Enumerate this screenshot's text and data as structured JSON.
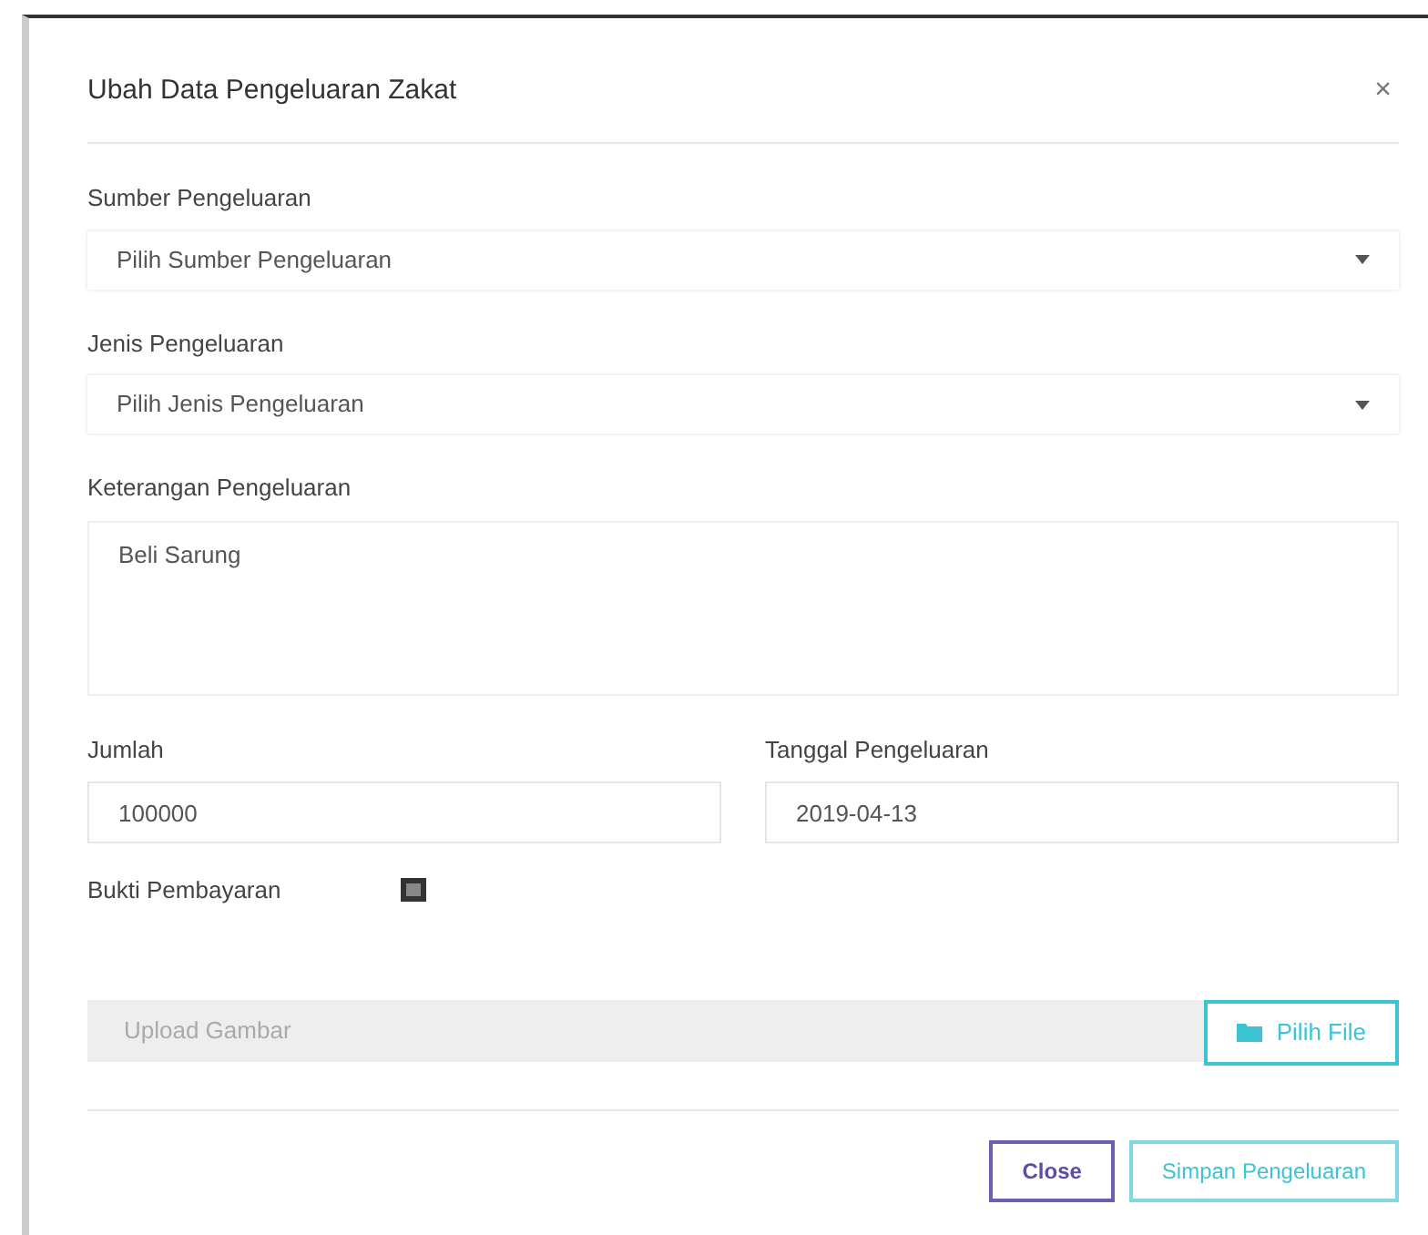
{
  "modal": {
    "title": "Ubah Data Pengeluaran Zakat",
    "close": "×"
  },
  "fields": [
    {
      "kind": "select",
      "label": "Sumber Pengeluaran",
      "value": "Pilih Sumber Pengeluaran"
    },
    {
      "kind": "select",
      "label": "Jenis Pengeluaran",
      "value": "Pilih Jenis Pengeluaran"
    },
    {
      "kind": "textarea",
      "label": "Keterangan Pengeluaran",
      "value": "Beli Sarung"
    }
  ],
  "row": [
    {
      "label": "Jumlah",
      "value": "100000"
    },
    {
      "label": "Tanggal Pengeluaran",
      "value": "2019-04-13"
    }
  ],
  "proof": {
    "label": "Bukti Pembayaran",
    "placeholder": "Upload Gambar",
    "button": "Pilih File"
  },
  "buttons": [
    {
      "kind": "close",
      "label": "Close"
    },
    {
      "kind": "save",
      "label": "Simpan Pengeluaran"
    }
  ]
}
